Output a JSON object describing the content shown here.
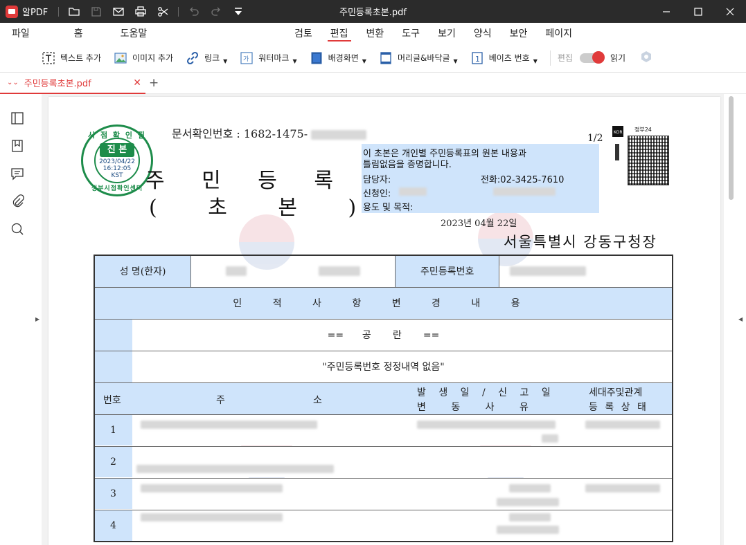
{
  "app": {
    "name": "알PDF",
    "window_title": "주민등록초본.pdf"
  },
  "menu": {
    "left": [
      "파일",
      "홈",
      "도움말"
    ],
    "center": [
      "검토",
      "편집",
      "변환",
      "도구",
      "보기",
      "양식",
      "보안",
      "페이지"
    ],
    "active": "편집"
  },
  "toolbar": {
    "add_text": "텍스트 추가",
    "add_image": "이미지 추가",
    "link": "링크",
    "watermark": "워터마크",
    "background": "배경화면",
    "header_footer": "머리글&바닥글",
    "bates": "베이츠 번호",
    "edit_label": "편집",
    "read_label": "읽기"
  },
  "tab": {
    "label": "주민등록초본.pdf",
    "add": "+"
  },
  "document": {
    "doc_number_label": "문서확인번호 : 1682-1475-",
    "page_indicator": "1/2",
    "title": "주 민 등 록 표",
    "subtitle": "( 초 본 )",
    "stamp": {
      "top": "시 점 확 인 필",
      "main": "진 본",
      "date": "2023/04/22",
      "time": "16:12:05",
      "tz": "KST",
      "bottom": "정부시점확인센터"
    },
    "cert_lines": [
      "이 초본은 개인별 주민등록표의 원본 내용과",
      "틀림없음을 증명합니다."
    ],
    "officer_label": "담당자:",
    "phone_label": "전화:02-3425-7610",
    "applicant_label": "신청인:",
    "purpose_label": "용도 및 목적:",
    "issue_date": "2023년 04월 22일",
    "office": "서울특별시 강동구청장",
    "qr_label": "정부24",
    "table": {
      "name_label": "성 명(한자)",
      "rrn_label": "주민등록번호",
      "section_title": "인 적 사 항 변 경 내 용",
      "empty_text": "==      공       란       ==",
      "no_change_text": "\"주민등록번호 정정내역 없음\"",
      "col_no": "번호",
      "col_addr1": "주",
      "col_addr2": "소",
      "col_date_top": "발 생 일 / 신 고 일",
      "col_date_bottom": "변 동 사 유",
      "col_house_top": "세대주및관계",
      "col_house_bottom": "등 록 상 태",
      "row_numbers": [
        "1",
        "2",
        "3",
        "4"
      ]
    }
  }
}
